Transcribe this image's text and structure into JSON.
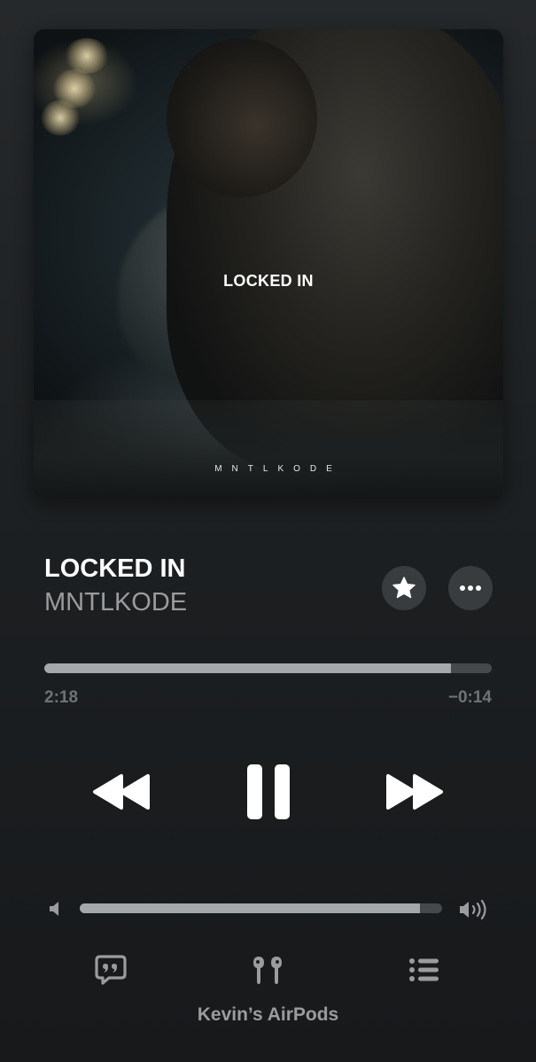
{
  "artwork": {
    "title_text": "LOCKED IN",
    "artist_text": "MNTLKODE"
  },
  "track": {
    "title": "LOCKED IN",
    "artist": "MNTLKODE"
  },
  "progress": {
    "elapsed": "2:18",
    "remaining": "−0:14",
    "fraction": 0.908
  },
  "volume": {
    "fraction": 0.938
  },
  "icons": {
    "favorite": "star-icon",
    "more": "ellipsis-icon",
    "rewind": "rewind-icon",
    "pause": "pause-icon",
    "forward": "fast-forward-icon",
    "volume_low": "speaker-low-icon",
    "volume_high": "speaker-high-icon",
    "lyrics": "lyrics-quote-icon",
    "airplay": "airpods-icon",
    "queue": "queue-list-icon"
  },
  "output_device": "Kevin’s AirPods",
  "colors": {
    "background": "#1d2022",
    "fill": "#a5a8aa",
    "track": "#45494b",
    "secondary_text": "#9a9c9e"
  }
}
